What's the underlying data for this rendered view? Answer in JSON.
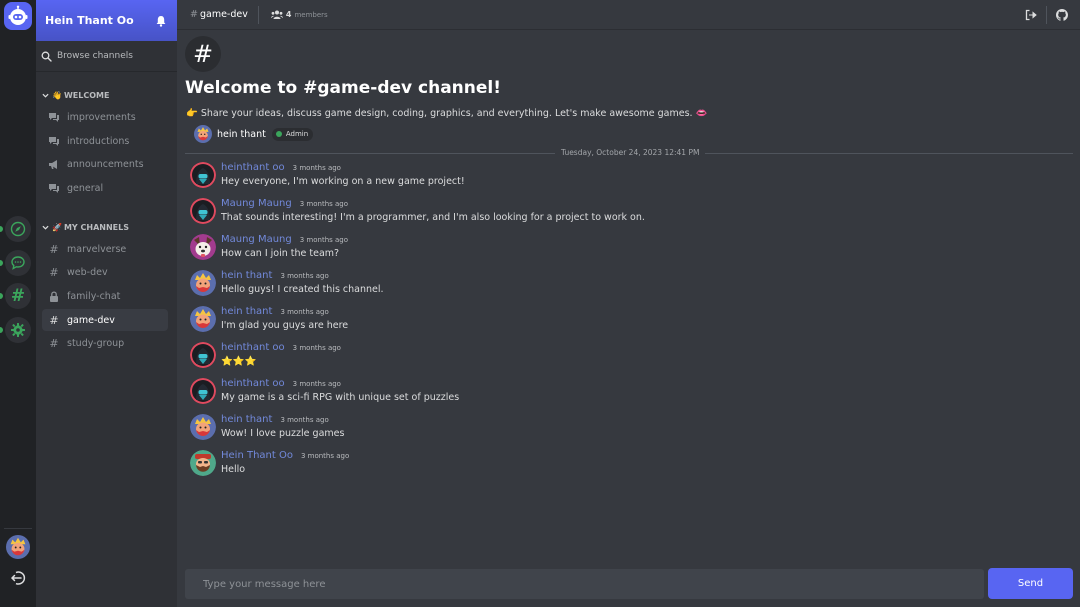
{
  "user": {
    "name": "Hein Thant Oo"
  },
  "sidebar": {
    "browse_label": "Browse channels",
    "categories": [
      {
        "label": "WELCOME",
        "emoji": "👋"
      },
      {
        "label": "MY CHANNELS",
        "emoji": "🚀"
      }
    ],
    "welcome_channels": [
      {
        "label": "improvements",
        "icon": "forum-icon"
      },
      {
        "label": "introductions",
        "icon": "forum-icon"
      },
      {
        "label": "announcements",
        "icon": "megaphone-icon"
      },
      {
        "label": "general",
        "icon": "forum-icon"
      }
    ],
    "my_channels": [
      {
        "label": "marvelverse",
        "icon": "hash-icon"
      },
      {
        "label": "web-dev",
        "icon": "hash-icon"
      },
      {
        "label": "family-chat",
        "icon": "lock-icon"
      },
      {
        "label": "game-dev",
        "icon": "hash-icon",
        "active": true
      },
      {
        "label": "study-group",
        "icon": "hash-icon"
      }
    ]
  },
  "topbar": {
    "channel": "game-dev",
    "member_count": "4",
    "member_label": "members"
  },
  "welcome": {
    "title": "Welcome to #game-dev channel!",
    "description": "👉 Share your ideas, discuss game design, coding, graphics, and everything. Let's make awesome games. 👄",
    "owner_name": "hein thant",
    "owner_badge": "Admin"
  },
  "date_separator": "Tuesday, October 24, 2023 12:41 PM",
  "messages": [
    {
      "author": "heinthant oo",
      "time": "3 months ago",
      "text": "Hey everyone, I'm working on a new game project!",
      "avatar": "hooded-avatar"
    },
    {
      "author": "Maung Maung",
      "time": "3 months ago",
      "text": "That sounds interesting! I'm a programmer, and I'm also looking for a project to work on.",
      "avatar": "hooded-avatar"
    },
    {
      "author": "Maung Maung",
      "time": "3 months ago",
      "text": "How can I join the team?",
      "avatar": "dog-avatar"
    },
    {
      "author": "hein thant",
      "time": "3 months ago",
      "text": "Hello guys! I created this channel.",
      "avatar": "warrior-avatar"
    },
    {
      "author": "hein thant",
      "time": "3 months ago",
      "text": "I'm glad you guys are here",
      "avatar": "warrior-avatar"
    },
    {
      "author": "heinthant oo",
      "time": "3 months ago",
      "text": "⭐⭐⭐",
      "avatar": "hooded-avatar"
    },
    {
      "author": "heinthant oo",
      "time": "3 months ago",
      "text": "My game is a sci-fi RPG with unique set of puzzles",
      "avatar": "hooded-avatar"
    },
    {
      "author": "hein thant",
      "time": "3 months ago",
      "text": "Wow! I love puzzle games",
      "avatar": "warrior-avatar"
    },
    {
      "author": "Hein Thant Oo",
      "time": "3 months ago",
      "text": "Hello",
      "avatar": "bearded-avatar"
    }
  ],
  "composer": {
    "placeholder": "Type your message here",
    "send_label": "Send"
  },
  "colors": {
    "accent": "#5865f2",
    "online": "#3ba55c",
    "username": "#7289da"
  }
}
